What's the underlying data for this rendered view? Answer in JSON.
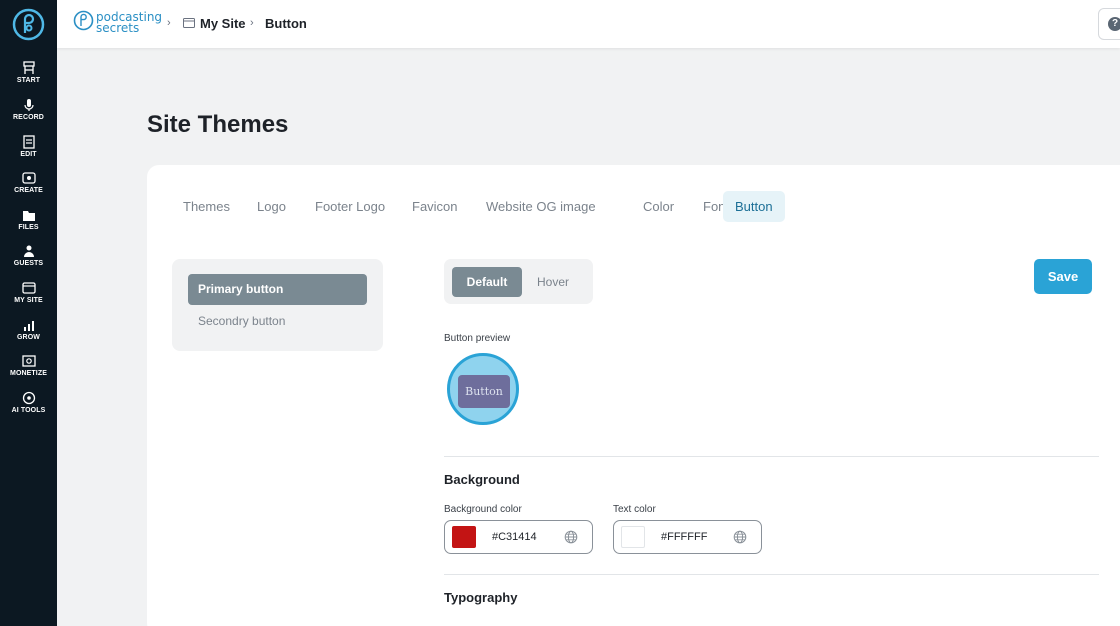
{
  "sidebar": {
    "items": [
      {
        "label": "START",
        "icon": "start-icon"
      },
      {
        "label": "RECORD",
        "icon": "microphone-icon"
      },
      {
        "label": "EDIT",
        "icon": "edit-icon"
      },
      {
        "label": "CREATE",
        "icon": "create-icon"
      },
      {
        "label": "FILES",
        "icon": "files-icon"
      },
      {
        "label": "GUESTS",
        "icon": "guests-icon"
      },
      {
        "label": "MY SITE",
        "icon": "my-site-icon"
      },
      {
        "label": "GROW",
        "icon": "grow-icon"
      },
      {
        "label": "MONETIZE",
        "icon": "monetize-icon"
      },
      {
        "label": "AI TOOLS",
        "icon": "ai-tools-icon"
      }
    ]
  },
  "header": {
    "brand_line1": "podcasting",
    "brand_line2": "secrets",
    "breadcrumb": [
      "My Site",
      "Button"
    ],
    "help_label": "?"
  },
  "page": {
    "title": "Site Themes"
  },
  "tabs": [
    "Themes",
    "Logo",
    "Footer Logo",
    "Favicon",
    "Website OG image",
    "Color",
    "Font",
    "Button"
  ],
  "active_tab": "Button",
  "button_types": {
    "primary": "Primary button",
    "secondary": "Secondry button"
  },
  "state_toggle": {
    "default": "Default",
    "hover": "Hover"
  },
  "save_label": "Save",
  "preview": {
    "label": "Button preview",
    "button_text": "Button"
  },
  "background": {
    "title": "Background",
    "bg_color_label": "Background color",
    "bg_color_value": "#C31414",
    "text_color_label": "Text color",
    "text_color_value": "#FFFFFF"
  },
  "typography": {
    "title": "Typography"
  },
  "colors": {
    "sidebar": "#0c1822",
    "accent": "#2aa3d6",
    "active_pill": "#7a8a93",
    "swatch_bg": "#C31414",
    "swatch_text": "#FFFFFF"
  }
}
